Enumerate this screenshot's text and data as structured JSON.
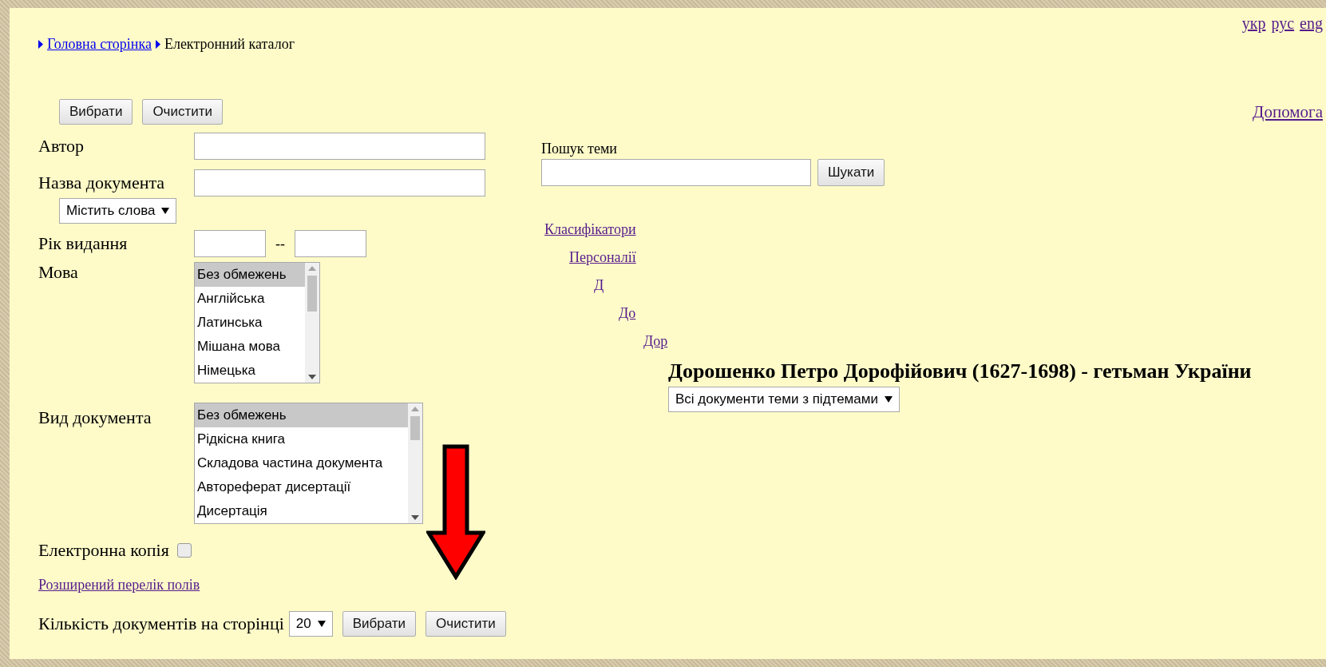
{
  "language_links": [
    "укр",
    "рус",
    "eng"
  ],
  "breadcrumb": [
    {
      "label": "Головна сторінка",
      "kind": "link"
    },
    {
      "label": "Електронний каталог",
      "kind": "current"
    }
  ],
  "top_buttons": [
    "Вибрати",
    "Очистити"
  ],
  "help_link": "Допомога",
  "form": {
    "author": {
      "label": "Автор"
    },
    "title": {
      "label": "Назва документа",
      "match_mode": "Містить слова"
    },
    "year": {
      "label": "Рік видання",
      "separator": "--"
    },
    "language": {
      "label": "Мова",
      "options": [
        {
          "label": "Без обмежень",
          "selected": true
        },
        {
          "label": "Англійська",
          "selected": false
        },
        {
          "label": "Латинська",
          "selected": false
        },
        {
          "label": "Мішана мова",
          "selected": false
        },
        {
          "label": "Німецька",
          "selected": false
        }
      ]
    },
    "doc_type": {
      "label": "Вид документа",
      "options": [
        {
          "label": "Без обмежень",
          "selected": true
        },
        {
          "label": "Рідкісна книга",
          "selected": false
        },
        {
          "label": "Складова частина документа",
          "selected": false
        },
        {
          "label": "Автореферат дисертації",
          "selected": false
        },
        {
          "label": "Дисертація",
          "selected": false
        }
      ]
    },
    "electronic_copy": {
      "label": "Електронна копія",
      "checked": false
    },
    "extended_fields_link": "Розширений перелік полів",
    "per_page": {
      "label": "Кількість документів на сторінці",
      "value": "20"
    }
  },
  "bottom_buttons": [
    "Вибрати",
    "Очистити"
  ],
  "topic_search": {
    "label": "Пошук теми",
    "button": "Шукати"
  },
  "topic_tree": [
    {
      "label": "Класифікатори",
      "kind": "link",
      "children": [
        {
          "label": "Персоналії",
          "kind": "link",
          "children": [
            {
              "label": "Д",
              "kind": "link",
              "children": [
                {
                  "label": "До",
                  "kind": "link",
                  "children": [
                    {
                      "label": "Дор",
                      "kind": "link",
                      "children": [
                        {
                          "label": "Дорошенко Петро Дорофійович (1627-1698) - гетьман України",
                          "kind": "current"
                        }
                      ]
                    }
                  ]
                }
              ]
            }
          ]
        }
      ]
    }
  ],
  "topic_scope": "Всі документи теми з підтемами"
}
